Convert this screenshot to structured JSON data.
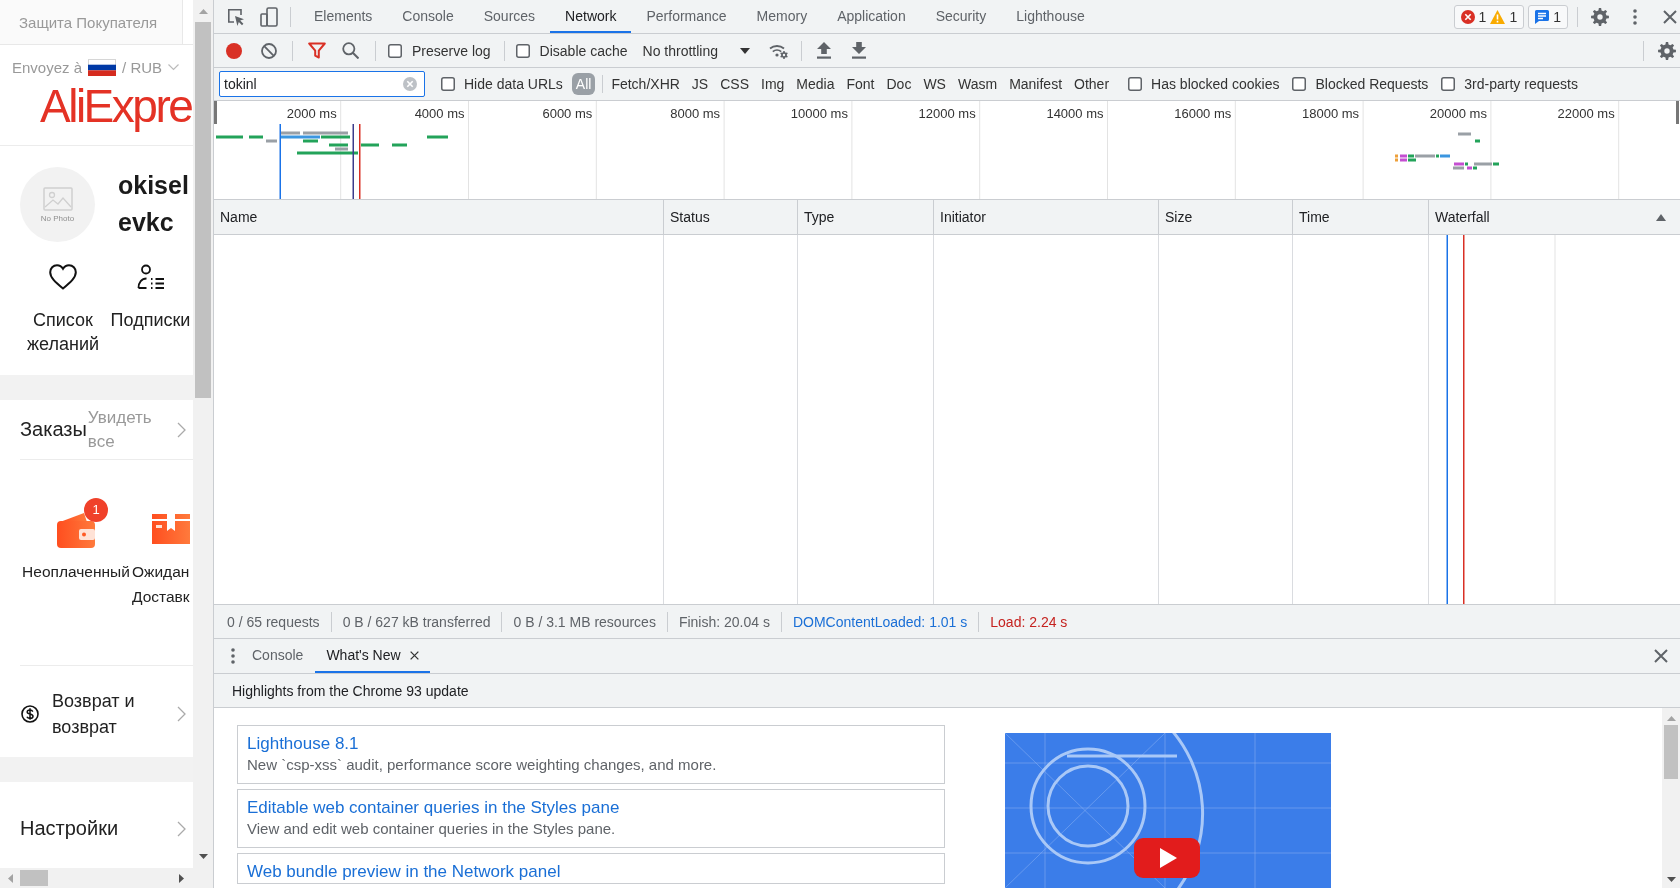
{
  "page": {
    "buyer_protection": "Защита Покупателя",
    "ship_to": {
      "label": "Envoyez à",
      "separator": "/",
      "currency": "RUB"
    },
    "logo": "AliExpre",
    "profile": {
      "avatar_caption": "No Photo",
      "username": "okisel evkc"
    },
    "shortcuts": [
      {
        "kind": "wishlist",
        "label": "Список желаний"
      },
      {
        "kind": "following",
        "label": "Подписки"
      }
    ],
    "orders": {
      "title": "Заказы",
      "view_all": "Увидеть все",
      "statuses": [
        {
          "kind": "unpaid",
          "label": "Неоплаченный",
          "badge": "1"
        },
        {
          "kind": "shipping",
          "label": "Ожидан Доставк"
        }
      ]
    },
    "menu": [
      {
        "kind": "refund",
        "label": "Возврат и возврат"
      },
      {
        "kind": "settings",
        "label": "Настройки"
      }
    ]
  },
  "devtools": {
    "tabs": [
      {
        "label": "Elements",
        "selected": false
      },
      {
        "label": "Console",
        "selected": false
      },
      {
        "label": "Sources",
        "selected": false
      },
      {
        "label": "Network",
        "selected": true
      },
      {
        "label": "Performance",
        "selected": false
      },
      {
        "label": "Memory",
        "selected": false
      },
      {
        "label": "Application",
        "selected": false
      },
      {
        "label": "Security",
        "selected": false
      },
      {
        "label": "Lighthouse",
        "selected": false
      }
    ],
    "issues": {
      "errors": "1",
      "warnings": "1",
      "messages": "1"
    },
    "network_toolbar": {
      "recording": true,
      "filter_active": true,
      "preserve_log": {
        "label": "Preserve log",
        "checked": false
      },
      "disable_cache": {
        "label": "Disable cache",
        "checked": false
      },
      "throttling": "No throttling"
    },
    "filter_bar": {
      "filter_value": "tokinl",
      "hide_data_urls": {
        "label": "Hide data URLs",
        "checked": false
      },
      "resource_types": [
        {
          "label": "All",
          "selected": true
        },
        {
          "label": "Fetch/XHR",
          "selected": false
        },
        {
          "label": "JS",
          "selected": false
        },
        {
          "label": "CSS",
          "selected": false
        },
        {
          "label": "Img",
          "selected": false
        },
        {
          "label": "Media",
          "selected": false
        },
        {
          "label": "Font",
          "selected": false
        },
        {
          "label": "Doc",
          "selected": false
        },
        {
          "label": "WS",
          "selected": false
        },
        {
          "label": "Wasm",
          "selected": false
        },
        {
          "label": "Manifest",
          "selected": false
        },
        {
          "label": "Other",
          "selected": false
        }
      ],
      "options": [
        {
          "label": "Has blocked cookies",
          "checked": false
        },
        {
          "label": "Blocked Requests",
          "checked": false
        },
        {
          "label": "3rd-party requests",
          "checked": false
        }
      ]
    },
    "overview": {
      "ticks": [
        "2000 ms",
        "4000 ms",
        "6000 ms",
        "8000 ms",
        "10000 ms",
        "12000 ms",
        "14000 ms",
        "16000 ms",
        "18000 ms",
        "20000 ms",
        "22000 ms"
      ]
    },
    "request_table": {
      "columns": [
        {
          "label": "Name",
          "sorted": false
        },
        {
          "label": "Status",
          "sorted": false
        },
        {
          "label": "Type",
          "sorted": false
        },
        {
          "label": "Initiator",
          "sorted": false
        },
        {
          "label": "Size",
          "sorted": false
        },
        {
          "label": "Time",
          "sorted": false
        },
        {
          "label": "Waterfall",
          "sorted": true
        }
      ]
    },
    "status_bar": [
      {
        "kind": "plain",
        "text": "0 / 65 requests"
      },
      {
        "kind": "plain",
        "text": "0 B / 627 kB transferred"
      },
      {
        "kind": "plain",
        "text": "0 B / 3.1 MB resources"
      },
      {
        "kind": "plain",
        "text": "Finish: 20.04 s"
      },
      {
        "kind": "domcontentloaded",
        "text": "DOMContentLoaded: 1.01 s"
      },
      {
        "kind": "load",
        "text": "Load: 2.24 s"
      }
    ],
    "drawer": {
      "tabs": [
        {
          "label": "Console",
          "selected": false,
          "closable": false
        },
        {
          "label": "What's New",
          "selected": true,
          "closable": true
        }
      ],
      "heading": "Highlights from the Chrome 93 update",
      "items": [
        {
          "title": "Lighthouse 8.1",
          "description": "New `csp-xss` audit, performance score weighting changes, and more."
        },
        {
          "title": "Editable web container queries in the Styles pane",
          "description": "View and edit web container queries in the Styles pane."
        },
        {
          "title": "Web bundle preview in the Network panel"
        }
      ]
    }
  }
}
